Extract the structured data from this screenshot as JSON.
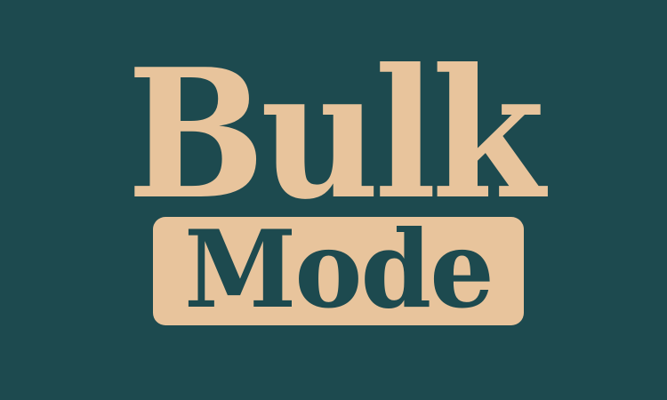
{
  "logo": {
    "line1": "Bulk",
    "line2": "Mode"
  },
  "colors": {
    "background": "#1d4a4f",
    "accent": "#e8c49c"
  }
}
